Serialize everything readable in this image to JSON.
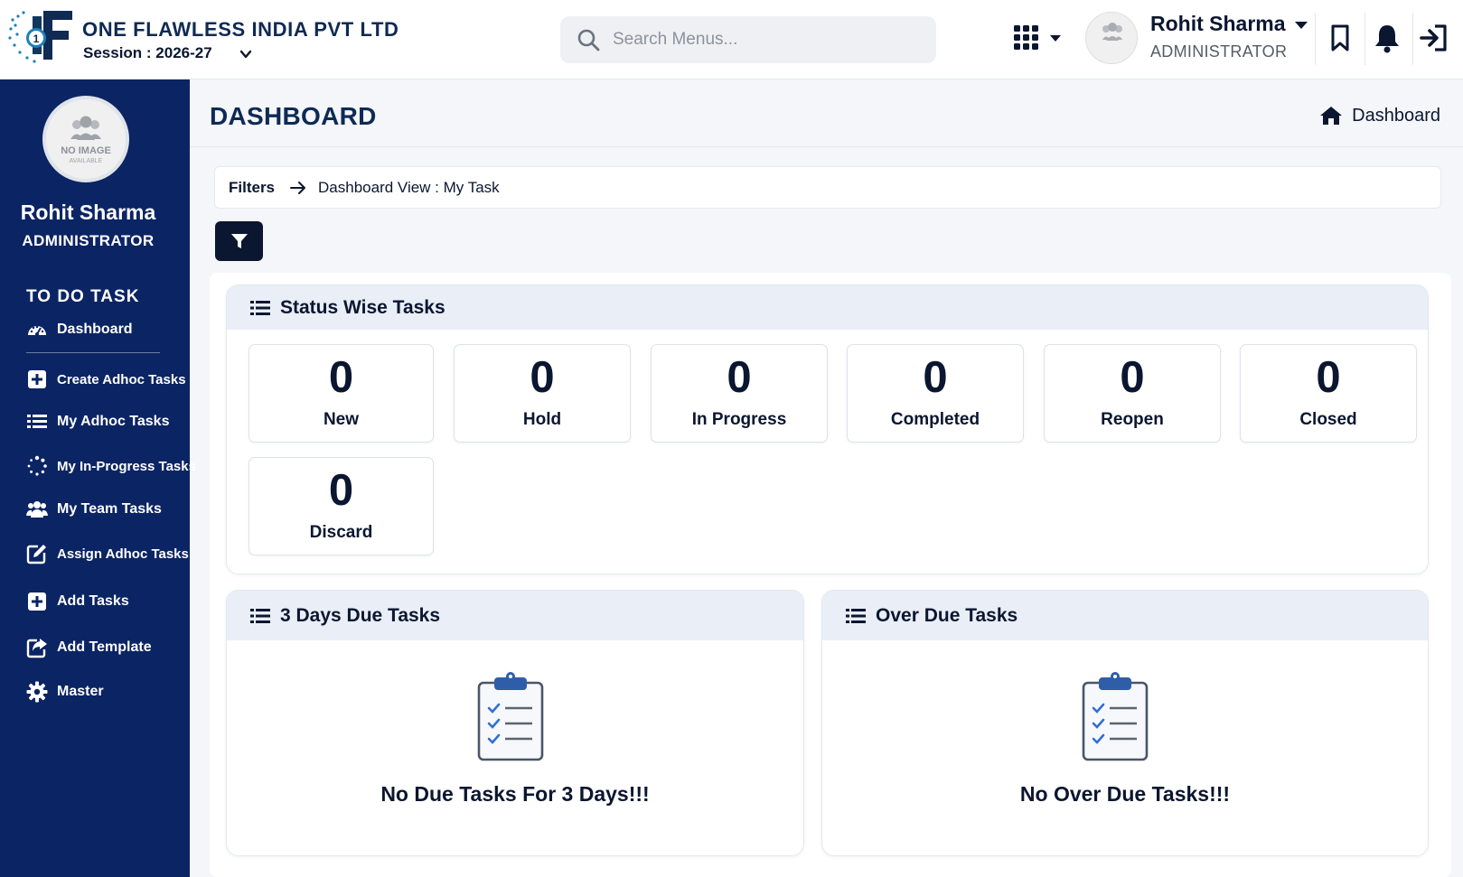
{
  "header": {
    "company_name": "ONE FLAWLESS INDIA PVT LTD",
    "session_label": "Session : 2026-27",
    "search_placeholder": "Search Menus...",
    "user_name": "Rohit Sharma",
    "user_role": "ADMINISTRATOR",
    "avatar_text_1": "NO IMAGE",
    "avatar_text_2": "AVAILABLE",
    "icons": [
      "apps-grid-icon",
      "bookmark-icon",
      "bell-icon",
      "logout-icon"
    ]
  },
  "sidebar": {
    "avatar_text_1": "NO IMAGE",
    "avatar_text_2": "AVAILABLE",
    "user_name": "Rohit Sharma",
    "user_role": "ADMINISTRATOR",
    "section_title": "TO DO TASK",
    "items": [
      {
        "label": "Dashboard",
        "icon": "gauge-icon"
      },
      {
        "label": "Create Adhoc Tasks",
        "icon": "plus-square-icon"
      },
      {
        "label": "My Adhoc Tasks",
        "icon": "list-icon"
      },
      {
        "label": "My In-Progress Tasks",
        "icon": "spinner-icon"
      },
      {
        "label": "My Team Tasks",
        "icon": "users-icon"
      },
      {
        "label": "Assign Adhoc Tasks",
        "icon": "edit-icon"
      },
      {
        "label": "Add Tasks",
        "icon": "plus-square-icon"
      },
      {
        "label": "Add Template",
        "icon": "share-square-icon"
      },
      {
        "label": "Master",
        "icon": "gear-icon"
      }
    ]
  },
  "page": {
    "title": "DASHBOARD",
    "breadcrumb": "Dashboard"
  },
  "filters": {
    "label": "Filters",
    "view": "Dashboard View : My Task"
  },
  "status_card": {
    "title": "Status Wise Tasks",
    "stats": [
      {
        "value": "0",
        "label": "New"
      },
      {
        "value": "0",
        "label": "Hold"
      },
      {
        "value": "0",
        "label": "In Progress"
      },
      {
        "value": "0",
        "label": "Completed"
      },
      {
        "value": "0",
        "label": "Reopen"
      },
      {
        "value": "0",
        "label": "Closed"
      },
      {
        "value": "0",
        "label": "Discard"
      }
    ]
  },
  "due_card": {
    "title": "3 Days Due Tasks",
    "empty_text": "No Due Tasks For 3 Days!!!"
  },
  "overdue_card": {
    "title": "Over Due Tasks",
    "empty_text": "No Over Due Tasks!!!"
  },
  "colors": {
    "sidebar_bg": "#0b2463",
    "brand_navy": "#0e2a55",
    "card_header_bg": "#e9eef7",
    "filter_button_bg": "#0b1630"
  }
}
